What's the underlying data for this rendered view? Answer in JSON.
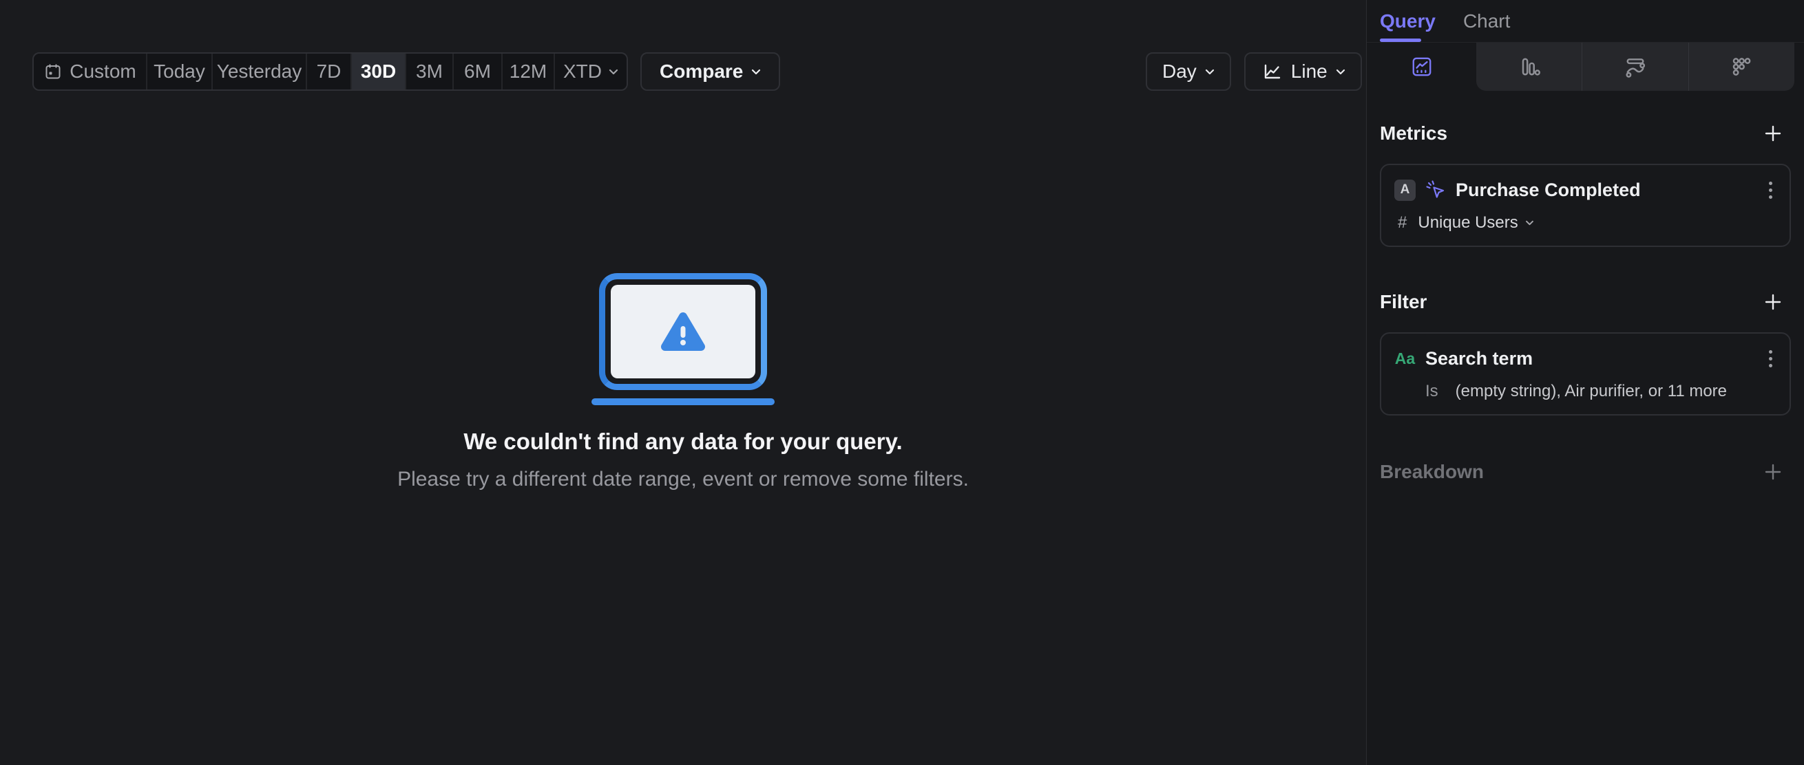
{
  "toolbar": {
    "date_ranges": [
      {
        "label": "Custom",
        "selected": false
      },
      {
        "label": "Today",
        "selected": false
      },
      {
        "label": "Yesterday",
        "selected": false
      },
      {
        "label": "7D",
        "selected": false
      },
      {
        "label": "30D",
        "selected": true
      },
      {
        "label": "3M",
        "selected": false
      },
      {
        "label": "6M",
        "selected": false
      },
      {
        "label": "12M",
        "selected": false
      },
      {
        "label": "XTD",
        "selected": false
      }
    ],
    "compare_label": "Compare",
    "granularity": {
      "value": "Day"
    },
    "chart_type": {
      "value": "Line"
    }
  },
  "empty_state": {
    "title": "We couldn't find any data for your query.",
    "subtitle": "Please try a different date range, event or remove some filters.",
    "illustration": "laptop-with-warning-triangle"
  },
  "sidebar": {
    "tabs": [
      {
        "label": "Query",
        "active": true
      },
      {
        "label": "Chart",
        "active": false
      }
    ],
    "visualization_tabs": [
      {
        "icon": "insights-line-chart-icon",
        "active": true
      },
      {
        "icon": "funnel-bars-icon",
        "active": false
      },
      {
        "icon": "flows-icon",
        "active": false
      },
      {
        "icon": "retention-dots-icon",
        "active": false
      }
    ],
    "metrics": {
      "header": "Metrics",
      "add_label": "+",
      "items": [
        {
          "series_letter": "A",
          "event_icon": "click-event-icon",
          "event_name": "Purchase Completed",
          "aggregation_prefix": "#",
          "aggregation": "Unique Users"
        }
      ]
    },
    "filter": {
      "header": "Filter",
      "add_label": "+",
      "items": [
        {
          "property_type": "Aa",
          "property_name": "Search term",
          "operator": "Is",
          "values_summary": "(empty string), Air purifier, or 11 more"
        }
      ]
    },
    "breakdown": {
      "header": "Breakdown",
      "add_label": "+"
    }
  },
  "colors": {
    "accent_purple": "#7b79f8",
    "property_green": "#36a876",
    "illustration_blue": "#3f8ce8",
    "canvas_bg": "#1a1b1e",
    "sidebar_bg": "#17181b"
  }
}
